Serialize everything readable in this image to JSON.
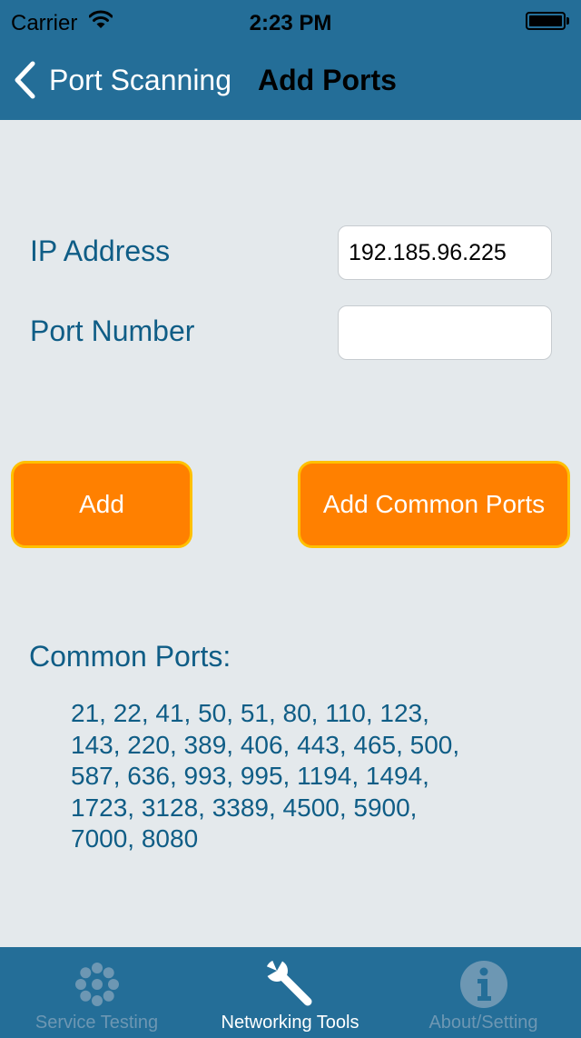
{
  "status_bar": {
    "carrier": "Carrier",
    "time": "2:23 PM"
  },
  "nav": {
    "back_label": "Port Scanning",
    "title": "Add Ports"
  },
  "form": {
    "ip_label": "IP Address",
    "ip_value": "192.185.96.225",
    "port_label": "Port Number",
    "port_value": ""
  },
  "buttons": {
    "add": "Add",
    "add_common": "Add Common Ports"
  },
  "common_ports": {
    "heading": "Common Ports:",
    "lines": [
      "21, 22, 41, 50, 51, 80, 110, 123,",
      "143, 220, 389, 406, 443, 465, 500,",
      "587, 636, 993, 995, 1194, 1494,",
      "1723, 3128, 3389, 4500, 5900,",
      "7000, 8080"
    ]
  },
  "tabs": [
    {
      "label": "Service Testing",
      "icon": "gear-icon",
      "active": false
    },
    {
      "label": "Networking Tools",
      "icon": "wrench-icon",
      "active": true
    },
    {
      "label": "About/Setting",
      "icon": "info-icon",
      "active": false
    }
  ],
  "colors": {
    "bar": "#246e98",
    "background": "#e4e9ec",
    "label_text": "#0f5d86",
    "button_fill": "#ff8000",
    "button_border": "#ffc000",
    "tab_inactive": "#6d97b3"
  }
}
